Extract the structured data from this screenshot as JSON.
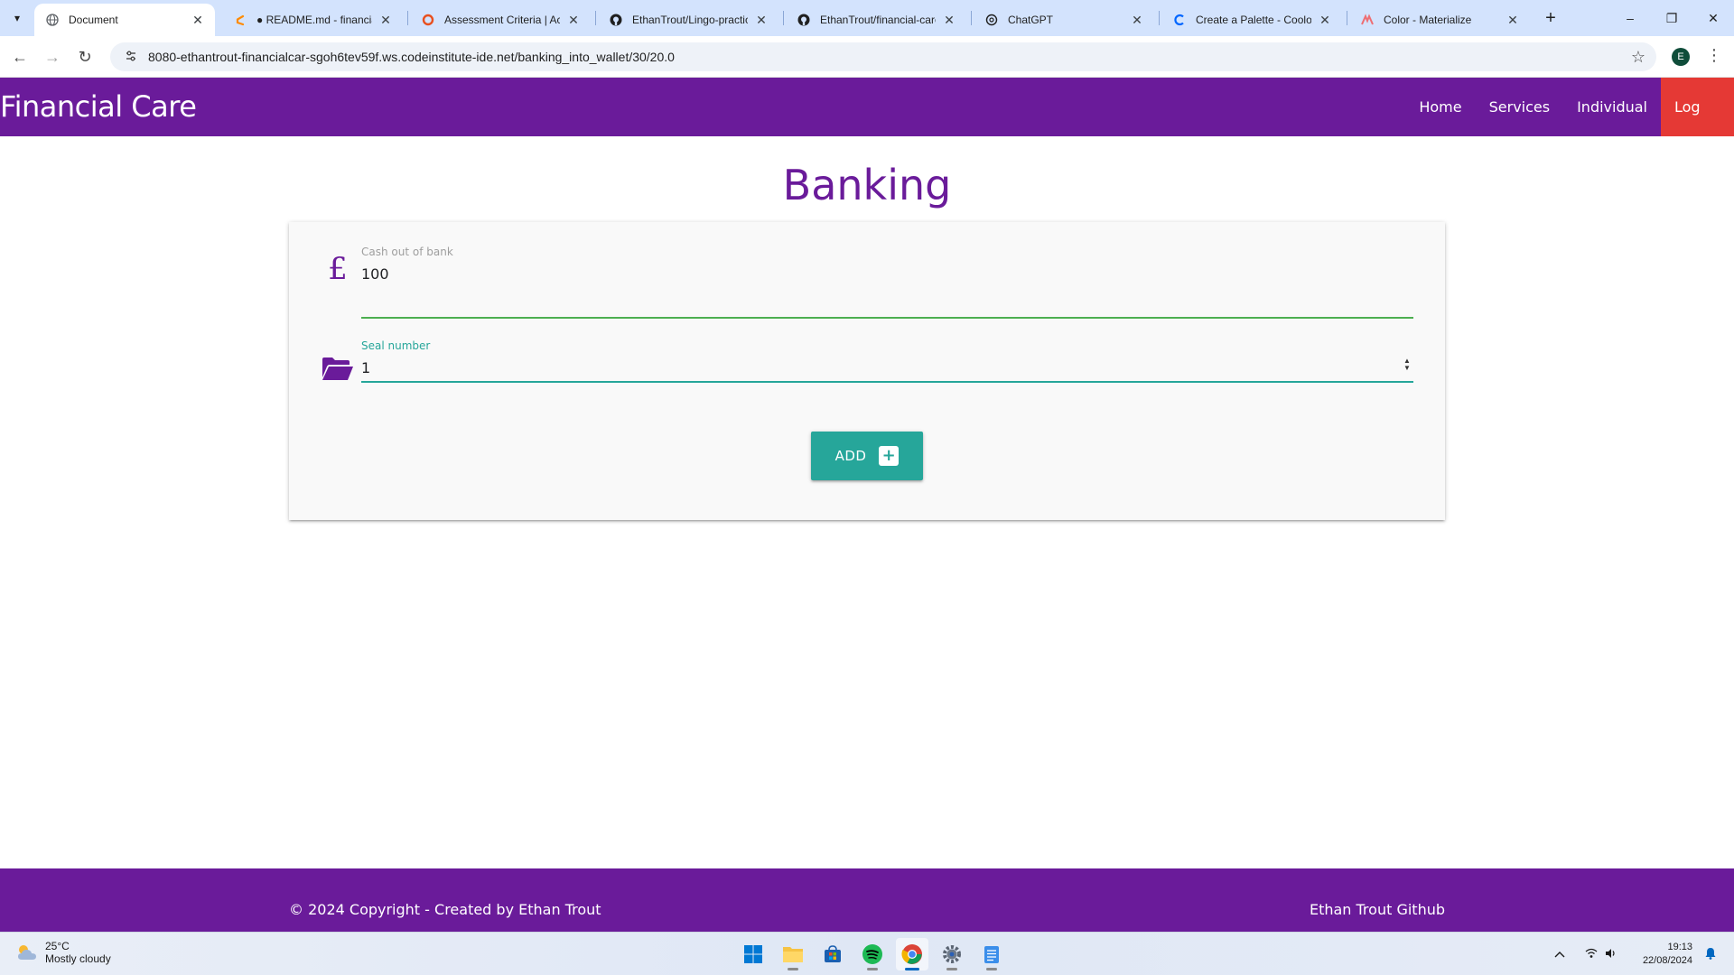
{
  "browser": {
    "tabs": [
      {
        "title": "Document",
        "active": true,
        "icon": "globe-icon"
      },
      {
        "title": "● README.md - financial-",
        "active": false,
        "icon": "gitpod-icon"
      },
      {
        "title": "Assessment Criteria | Acti",
        "active": false,
        "icon": "ring-icon"
      },
      {
        "title": "EthanTrout/Lingo-practice",
        "active": false,
        "icon": "github-icon"
      },
      {
        "title": "EthanTrout/financial-care",
        "active": false,
        "icon": "github-icon"
      },
      {
        "title": "ChatGPT",
        "active": false,
        "icon": "openai-icon"
      },
      {
        "title": "Create a Palette - Coolors",
        "active": false,
        "icon": "coolors-icon"
      },
      {
        "title": "Color - Materialize",
        "active": false,
        "icon": "materialize-icon"
      }
    ],
    "url": "8080-ethantrout-financialcar-sgoh6tev59f.ws.codeinstitute-ide.net/banking_into_wallet/30/20.0",
    "profile_initial": "E"
  },
  "site": {
    "brand": "Financial Care",
    "nav": {
      "home": "Home",
      "services": "Services",
      "individual": "Individual",
      "logout": "Log out"
    },
    "heading": "Banking",
    "form": {
      "cash_label": "Cash out of bank",
      "cash_value": "100",
      "cash_prefix": "£",
      "seal_label": "Seal number",
      "seal_value": "1",
      "submit_label": "ADD",
      "submit_icon": "+"
    },
    "footer": {
      "copyright": "© 2024 Copyright - Created by Ethan Trout",
      "github_link": "Ethan Trout Github"
    },
    "colors": {
      "primary": "#6a1b9a",
      "logout": "#e53935",
      "button": "#26a69a",
      "valid_line": "#4caf50",
      "focus_line": "#26a69a"
    }
  },
  "taskbar": {
    "weather_temp": "25°C",
    "weather_desc": "Mostly cloudy",
    "time": "19:13",
    "date": "22/08/2024"
  }
}
